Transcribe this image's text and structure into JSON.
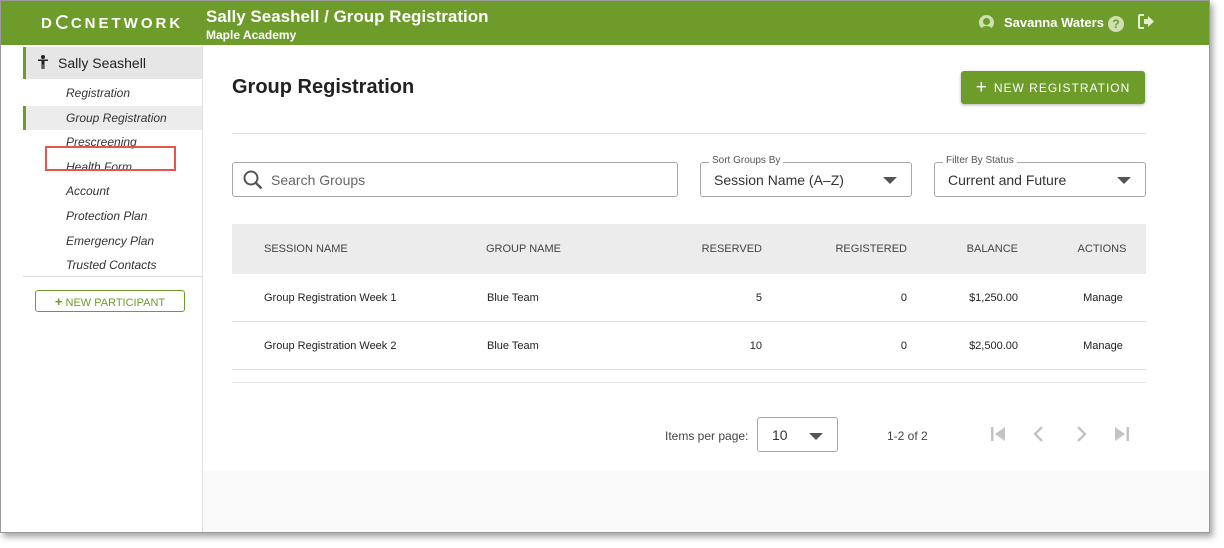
{
  "header": {
    "logo_text": "DOCNETWORK",
    "title": "Sally Seashell / Group Registration",
    "subtitle": "Maple Academy",
    "user_name": "Savanna Waters",
    "help_glyph": "?",
    "logout_glyph": "⮕",
    "accent": "#6e9c2a"
  },
  "sidebar": {
    "participant_name": "Sally Seashell",
    "participant_glyph": "🯅",
    "items": [
      {
        "label": "Registration"
      },
      {
        "label": "Group Registration"
      },
      {
        "label": "Prescreening"
      },
      {
        "label": "Health Form"
      },
      {
        "label": "Account"
      },
      {
        "label": "Protection Plan"
      },
      {
        "label": "Emergency Plan"
      },
      {
        "label": "Trusted Contacts"
      }
    ],
    "active_index": 1,
    "new_participant": "NEW PARTICIPANT"
  },
  "main": {
    "page_title": "Group Registration",
    "new_registration": "NEW REGISTRATION",
    "search_placeholder": "Search Groups",
    "sort": {
      "label": "Sort Groups By",
      "value": "Session Name (A–Z)"
    },
    "filter": {
      "label": "Filter By Status",
      "value": "Current and Future"
    }
  },
  "table": {
    "headers": {
      "session": "SESSION NAME",
      "group": "GROUP NAME",
      "reserved": "RESERVED",
      "registered": "REGISTERED",
      "balance": "BALANCE",
      "actions": "ACTIONS"
    },
    "rows": [
      {
        "session": "Group Registration Week 1",
        "group": "Blue Team",
        "reserved": "5",
        "registered": "0",
        "balance": "$1,250.00",
        "action": "Manage"
      },
      {
        "session": "Group Registration Week 2",
        "group": "Blue Team",
        "reserved": "10",
        "registered": "0",
        "balance": "$2,500.00",
        "action": "Manage"
      }
    ]
  },
  "pagination": {
    "items_per_page_label": "Items per page:",
    "items_per_page": "10",
    "range": "1-2 of 2"
  }
}
